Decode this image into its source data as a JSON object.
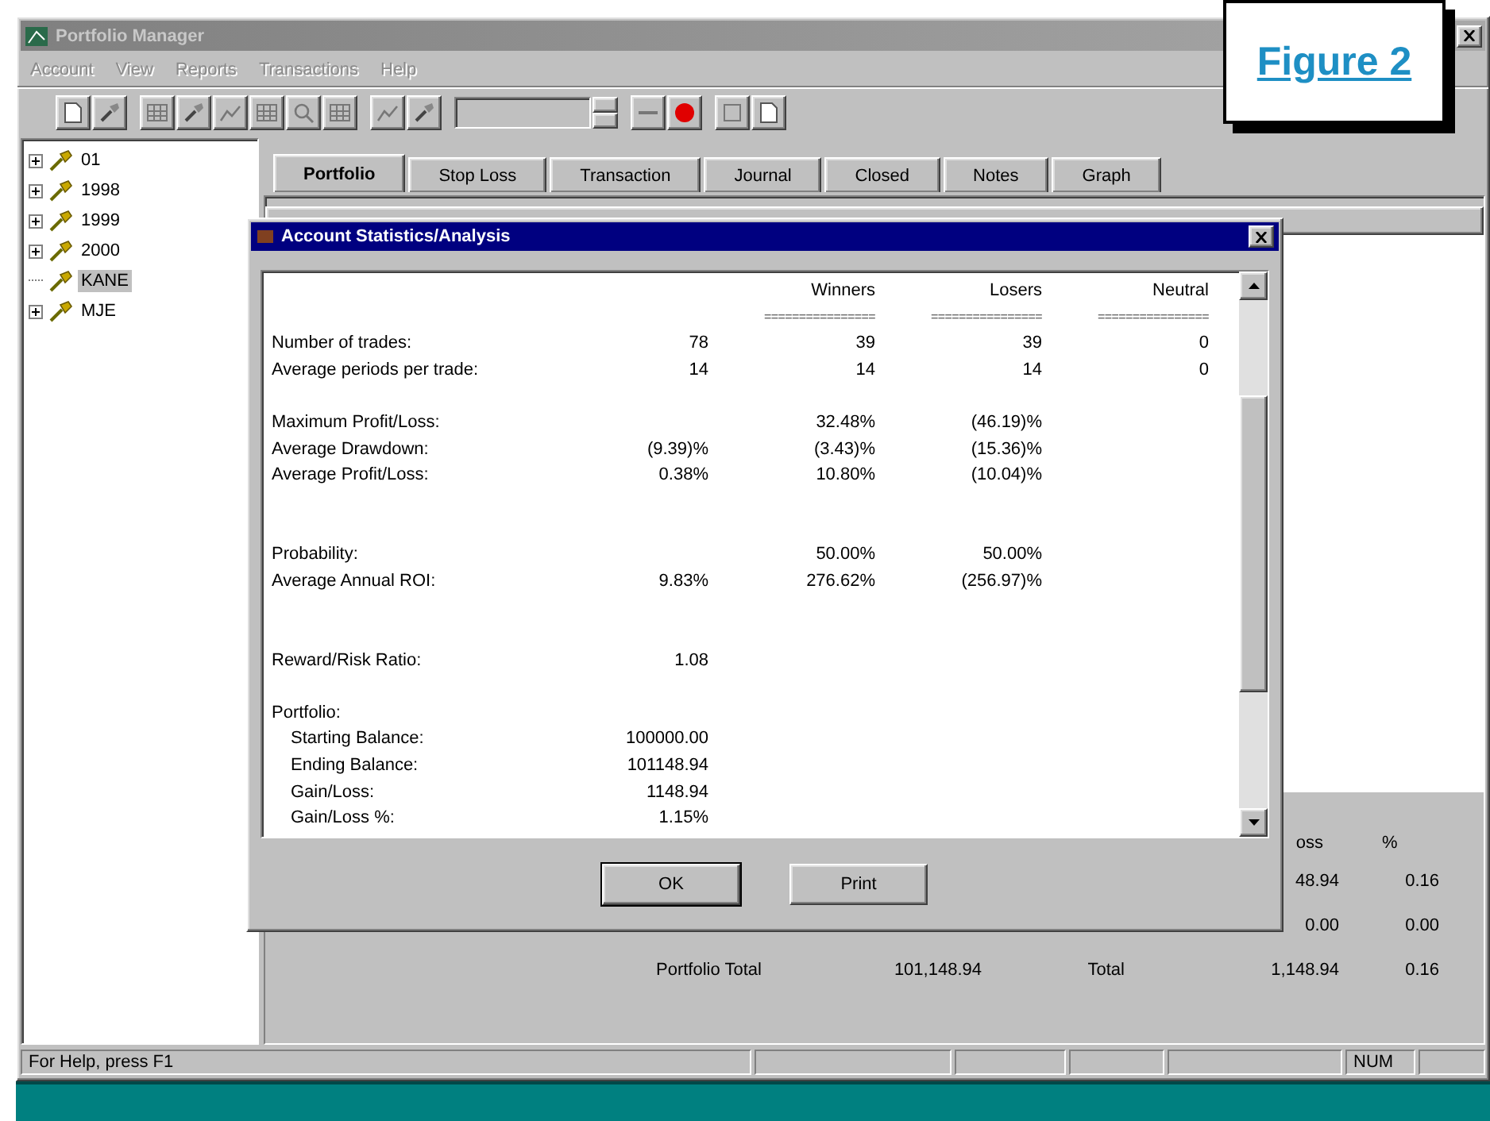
{
  "window": {
    "title": "Portfolio Manager"
  },
  "menu": [
    {
      "label": "Account",
      "disabled": true
    },
    {
      "label": "View",
      "disabled": true
    },
    {
      "label": "Reports",
      "disabled": true
    },
    {
      "label": "Transactions",
      "disabled": true
    },
    {
      "label": "Help",
      "disabled": true
    }
  ],
  "tree": [
    {
      "label": "01",
      "expandable": true,
      "selected": false
    },
    {
      "label": "1998",
      "expandable": true,
      "selected": false
    },
    {
      "label": "1999",
      "expandable": true,
      "selected": false
    },
    {
      "label": "2000",
      "expandable": true,
      "selected": false
    },
    {
      "label": "KANE",
      "expandable": false,
      "selected": true
    },
    {
      "label": "MJE",
      "expandable": true,
      "selected": false
    }
  ],
  "tabs": [
    {
      "label": "Portfolio",
      "selected": true
    },
    {
      "label": "Stop Loss",
      "selected": false
    },
    {
      "label": "Transaction",
      "selected": false
    },
    {
      "label": "Journal",
      "selected": false
    },
    {
      "label": "Closed",
      "selected": false
    },
    {
      "label": "Notes",
      "selected": false
    },
    {
      "label": "Graph",
      "selected": false
    }
  ],
  "summary": {
    "header": [
      "oss",
      "%"
    ],
    "rows": [
      {
        "kind": "line",
        "gain": "48.94",
        "percent": "0.16"
      },
      {
        "kind": "line",
        "gain": "0.00",
        "percent": "0.00"
      },
      {
        "kind": "total",
        "label": "Portfolio Total",
        "value": "101,148.94",
        "total_label": "Total",
        "gain": "1,148.94",
        "percent": "0.16"
      }
    ]
  },
  "dialog": {
    "title": "Account Statistics/Analysis",
    "columns": [
      {
        "label": "Winners",
        "rule": "================"
      },
      {
        "label": "Losers",
        "rule": "================"
      },
      {
        "label": "Neutral",
        "rule": "================"
      }
    ],
    "rows": [
      {
        "kind": "stat",
        "label": "Number of trades:",
        "total": "78",
        "winners": "39",
        "losers": "39",
        "neutral": "0"
      },
      {
        "kind": "stat",
        "label": "Average periods per trade:",
        "total": "14",
        "winners": "14",
        "losers": "14",
        "neutral": "0"
      },
      {
        "kind": "spacer"
      },
      {
        "kind": "stat",
        "label": "Maximum Profit/Loss:",
        "winners": "32.48%",
        "losers": "(46.19)%"
      },
      {
        "kind": "stat",
        "label": "Average Drawdown:",
        "total": "(9.39)%",
        "winners": "(3.43)%",
        "losers": "(15.36)%"
      },
      {
        "kind": "stat",
        "label": "Average Profit/Loss:",
        "total": "0.38%",
        "winners": "10.80%",
        "losers": "(10.04)%"
      },
      {
        "kind": "spacer"
      },
      {
        "kind": "spacer"
      },
      {
        "kind": "stat",
        "label": "Probability:",
        "winners": "50.00%",
        "losers": "50.00%"
      },
      {
        "kind": "stat",
        "label": "Average Annual ROI:",
        "total": "9.83%",
        "winners": "276.62%",
        "losers": "(256.97)%"
      },
      {
        "kind": "spacer"
      },
      {
        "kind": "spacer"
      },
      {
        "kind": "stat",
        "label": "Reward/Risk Ratio:",
        "total": "1.08"
      },
      {
        "kind": "spacer"
      },
      {
        "kind": "group",
        "label": "Portfolio:",
        "children": [
          {
            "kind": "stat",
            "label": "Starting Balance:",
            "total": "100000.00"
          },
          {
            "kind": "stat",
            "label": "Ending Balance:",
            "total": "101148.94"
          },
          {
            "kind": "stat",
            "label": "Gain/Loss:",
            "total": "1148.94"
          },
          {
            "kind": "stat",
            "label": "Gain/Loss %:",
            "total": "1.15%"
          }
        ]
      }
    ],
    "buttons": [
      {
        "label": "OK",
        "default": true
      },
      {
        "label": "Print",
        "default": false
      }
    ]
  },
  "status_bar": {
    "message": "For Help, press F1",
    "indicators": [
      "NUM"
    ]
  },
  "figure_label": "Figure 2"
}
